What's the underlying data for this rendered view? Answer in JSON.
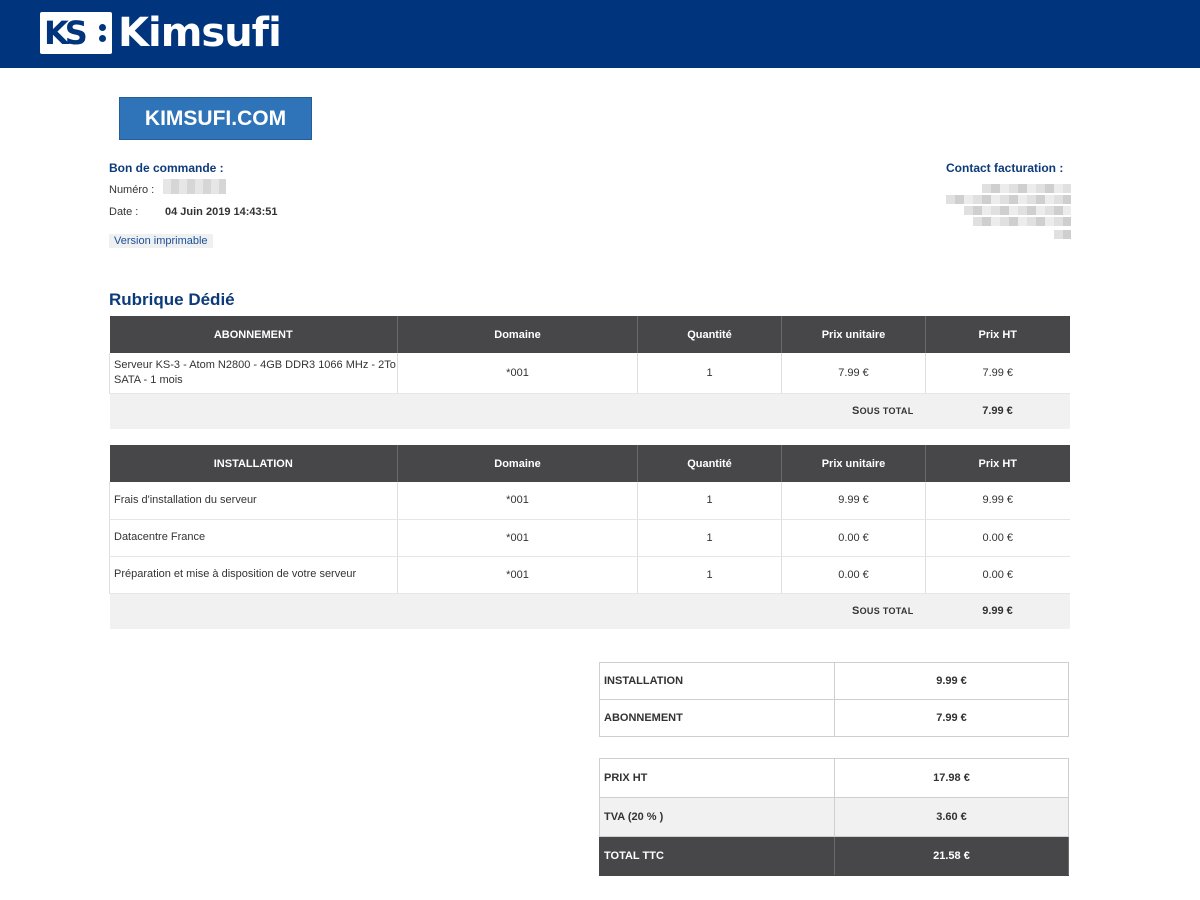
{
  "header": {
    "logo_text": "Kimsufi",
    "logo_badge": "KS"
  },
  "brand": {
    "label": "KIMSUFI.COM"
  },
  "order": {
    "title": "Bon de commande :",
    "numero_label": "Numéro :",
    "date_label": "Date :",
    "date_value": "04 Juin 2019 14:43:51",
    "print_link": "Version imprimable"
  },
  "contact": {
    "title": "Contact facturation :"
  },
  "section": {
    "title": "Rubrique Dédié"
  },
  "abonnement": {
    "headers": [
      "ABONNEMENT",
      "Domaine",
      "Quantité",
      "Prix unitaire",
      "Prix HT"
    ],
    "rows": [
      [
        "Serveur KS-3 - Atom N2800 - 4GB DDR3 1066 MHz - 2To SATA - 1 mois",
        "*001",
        "1",
        "7.99 €",
        "7.99 €"
      ]
    ],
    "subtotal_label_first": "S",
    "subtotal_label_rest": "OUS TOTAL",
    "subtotal_value": "7.99 €"
  },
  "installation": {
    "headers": [
      "INSTALLATION",
      "Domaine",
      "Quantité",
      "Prix unitaire",
      "Prix HT"
    ],
    "rows": [
      [
        "Frais d'installation du serveur",
        "*001",
        "1",
        "9.99 €",
        "9.99 €"
      ],
      [
        "Datacentre France",
        "*001",
        "1",
        "0.00 €",
        "0.00 €"
      ],
      [
        "Préparation et mise à disposition de votre serveur",
        "*001",
        "1",
        "0.00 €",
        "0.00 €"
      ]
    ],
    "subtotal_label_first": "S",
    "subtotal_label_rest": "OUS TOTAL",
    "subtotal_value": "9.99 €"
  },
  "summary1": [
    {
      "label": "INSTALLATION",
      "value": "9.99 €"
    },
    {
      "label": "ABONNEMENT",
      "value": "7.99 €"
    }
  ],
  "summary2": [
    {
      "label": "PRIX HT",
      "value": "17.98 €"
    },
    {
      "label": "TVA (20 % )",
      "value": "3.60 €"
    },
    {
      "label": "TOTAL TTC",
      "value": "21.58 €"
    }
  ],
  "colors": {
    "header_bg": "#00357d",
    "brand_box": "#2f74b8",
    "table_header": "#47474a",
    "title_blue": "#0d3b7a"
  }
}
